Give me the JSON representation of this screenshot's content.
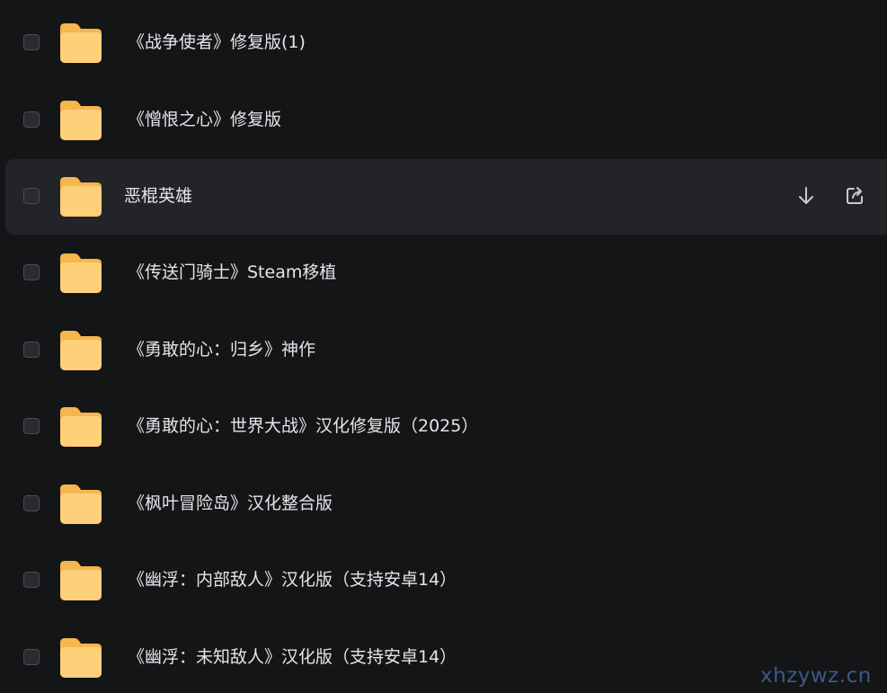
{
  "files": [
    {
      "name": "《战争使者》修复版(1)",
      "hovered": false
    },
    {
      "name": "《憎恨之心》修复版",
      "hovered": false
    },
    {
      "name": "恶棍英雄",
      "hovered": true
    },
    {
      "name": "《传送门骑士》Steam移植",
      "hovered": false
    },
    {
      "name": "《勇敢的心：归乡》神作",
      "hovered": false
    },
    {
      "name": "《勇敢的心：世界大战》汉化修复版（2025）",
      "hovered": false
    },
    {
      "name": "《枫叶冒险岛》汉化整合版",
      "hovered": false
    },
    {
      "name": "《幽浮：内部敌人》汉化版（支持安卓14）",
      "hovered": false
    },
    {
      "name": "《幽浮：未知敌人》汉化版（支持安卓14）",
      "hovered": false
    }
  ],
  "row_actions": {
    "download_icon": "download-icon",
    "share_icon": "share-icon"
  },
  "watermark": "xhzywz.cn",
  "colors": {
    "background": "#141517",
    "row_hover": "#232427",
    "text": "#e4e5e8",
    "folder_back": "#f5b64c",
    "folder_front": "#ffd07a",
    "watermark": "#3a5a86"
  }
}
